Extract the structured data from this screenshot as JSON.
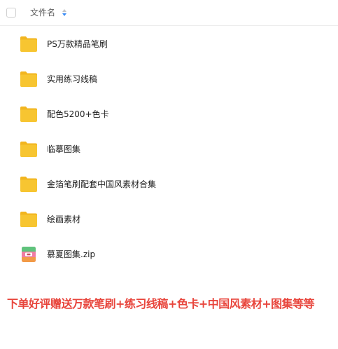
{
  "header": {
    "column_label": "文件名"
  },
  "files": [
    {
      "name": "PS万款精品笔刷",
      "type": "folder"
    },
    {
      "name": "实用练习线稿",
      "type": "folder"
    },
    {
      "name": "配色5200+色卡",
      "type": "folder"
    },
    {
      "name": "临摹图集",
      "type": "folder"
    },
    {
      "name": "金箔笔刷配套中国风素材合集",
      "type": "folder"
    },
    {
      "name": "绘画素材",
      "type": "folder"
    },
    {
      "name": "慕夏图集.zip",
      "type": "zip"
    }
  ],
  "promo_text": "下单好评赠送万款笔刷+练习线稿+色卡+中国风素材+图集等等",
  "colors": {
    "folder": "#f7c531",
    "folder_back": "#f2b51f",
    "promo": "#e8453c",
    "zip_green": "#5fc37c",
    "zip_pink": "#f07da4",
    "zip_orange": "#f29a47"
  }
}
